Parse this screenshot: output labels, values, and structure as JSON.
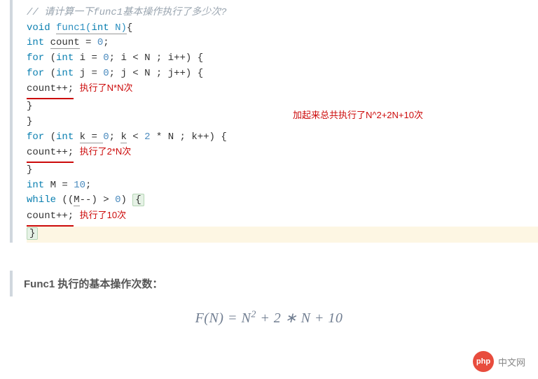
{
  "code": {
    "comment": "// 请计算一下func1基本操作执行了多少次?",
    "line2_kw1": "void",
    "line2_fn": "func1",
    "line2_kw2": "int",
    "line2_param": "N",
    "line3_kw": "int",
    "line3_var": "count",
    "line3_val": "0",
    "line4_kw1": "for",
    "line4_kw2": "int",
    "line4_init": "i = ",
    "line4_zero": "0",
    "line4_cond": "; i < N ; i++) {",
    "line5_kw1": "for",
    "line5_kw2": "int",
    "line5_init": "j = ",
    "line5_zero": "0",
    "line5_cond": "; j < N ; j++) {",
    "line6_stmt": "count++;",
    "line7_brace": "}",
    "line8_brace": "}",
    "line9_kw1": "for",
    "line9_kw2": "int",
    "line9_init": "k = ",
    "line9_zero": "0",
    "line9_cond1": "; ",
    "line9_var": "k",
    "line9_cond2": " < ",
    "line9_two": "2",
    "line9_cond3": " * N ; k++) {",
    "line10_stmt": "count++;",
    "line11_brace": "}",
    "line12_kw": "int",
    "line12_rest": " M = ",
    "line12_val": "10",
    "line12_semi": ";",
    "line13_kw": "while",
    "line13_a": " ((",
    "line13_var": "M",
    "line13_b": "--) > ",
    "line13_zero": "0",
    "line13_c": ") ",
    "line13_brace": "{",
    "line14_stmt": "count++;",
    "line15_brace": "}",
    "line16_brace": "}"
  },
  "annotations": {
    "nn": "执行了N*N次",
    "sum": "加起来总共执行了N^2+2N+10次",
    "two_n": "执行了2*N次",
    "ten": "执行了10次"
  },
  "summary": {
    "title": "Func1 执行的基本操作次数：",
    "formula_lhs": "F(N) = N",
    "formula_exp": "2",
    "formula_mid": " + 2 ∗ N + 10"
  },
  "watermark": {
    "logo": "php",
    "text": "中文网"
  }
}
